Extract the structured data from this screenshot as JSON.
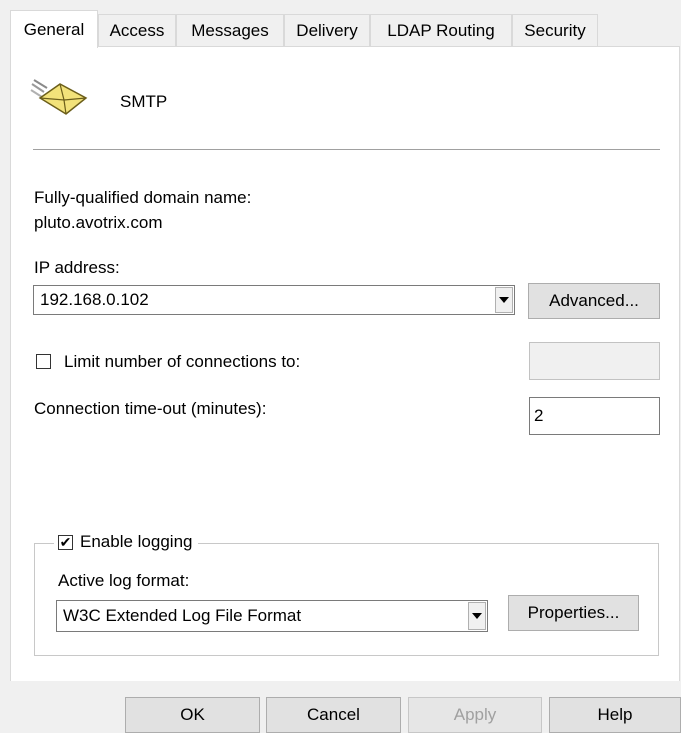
{
  "tabs": [
    "General",
    "Access",
    "Messages",
    "Delivery",
    "LDAP Routing",
    "Security"
  ],
  "service": {
    "name": "SMTP",
    "icon": "envelope-icon"
  },
  "fqdn": {
    "label": "Fully-qualified domain name:",
    "value": "pluto.avotrix.com"
  },
  "ip": {
    "label": "IP address:",
    "value": "192.168.0.102",
    "advanced_button": "Advanced..."
  },
  "limit_connections": {
    "label": "Limit number of connections to:",
    "checked": false,
    "value": ""
  },
  "timeout": {
    "label": "Connection time-out (minutes):",
    "value": "2"
  },
  "logging": {
    "enable_label": "Enable logging",
    "enabled": true,
    "format_label": "Active log format:",
    "format_value": "W3C Extended Log File Format",
    "properties_button": "Properties..."
  },
  "buttons": {
    "ok": "OK",
    "cancel": "Cancel",
    "apply": "Apply",
    "help": "Help"
  }
}
